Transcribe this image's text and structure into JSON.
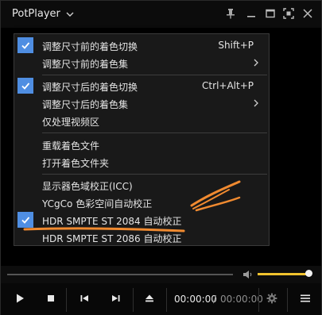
{
  "app": {
    "title": "PotPlayer"
  },
  "menu": {
    "items": [
      {
        "label": "调整尺寸前的着色切换",
        "shortcut": "Shift+P",
        "checked": true,
        "submenu": false
      },
      {
        "label": "调整尺寸前的着色集",
        "shortcut": "",
        "checked": false,
        "submenu": true
      },
      {
        "label": "调整尺寸后的着色切换",
        "shortcut": "Ctrl+Alt+P",
        "checked": true,
        "submenu": false
      },
      {
        "label": "调整尺寸后的着色集",
        "shortcut": "",
        "checked": false,
        "submenu": true
      },
      {
        "label": "仅处理视频区",
        "shortcut": "",
        "checked": false,
        "submenu": false
      },
      {
        "label": "重载着色文件",
        "shortcut": "",
        "checked": false,
        "submenu": false
      },
      {
        "label": "打开着色文件夹",
        "shortcut": "",
        "checked": false,
        "submenu": false
      },
      {
        "label": "显示器色域校正(ICC)",
        "shortcut": "",
        "checked": false,
        "submenu": false
      },
      {
        "label": "YCgCo 色彩空间自动校正",
        "shortcut": "",
        "checked": false,
        "submenu": false
      },
      {
        "label": "HDR SMPTE ST 2084 自动校正",
        "shortcut": "",
        "checked": true,
        "submenu": false
      },
      {
        "label": "HDR SMPTE ST 2086 自动校正",
        "shortcut": "",
        "checked": false,
        "submenu": false
      }
    ]
  },
  "playback": {
    "current_time": "00:00:00",
    "separator": "/",
    "total_time": "00:00:00",
    "volume_level": 1.0
  },
  "icons": {
    "title_chevron": "chevron-down-icon",
    "pin": "pin-icon",
    "minimize": "minimize-icon",
    "maximize": "maximize-icon",
    "fullscreen": "fullscreen-icon",
    "close": "close-icon",
    "play": "play-icon",
    "stop": "stop-icon",
    "prev": "previous-icon",
    "next": "next-icon",
    "eject": "eject-icon",
    "settings": "gear-icon",
    "menu": "hamburger-menu-icon",
    "volume": "speaker-icon"
  },
  "colors": {
    "check_bg": "#4f8ee2",
    "volume_fill": "#f0c22e",
    "annotation": "#f08a30"
  }
}
